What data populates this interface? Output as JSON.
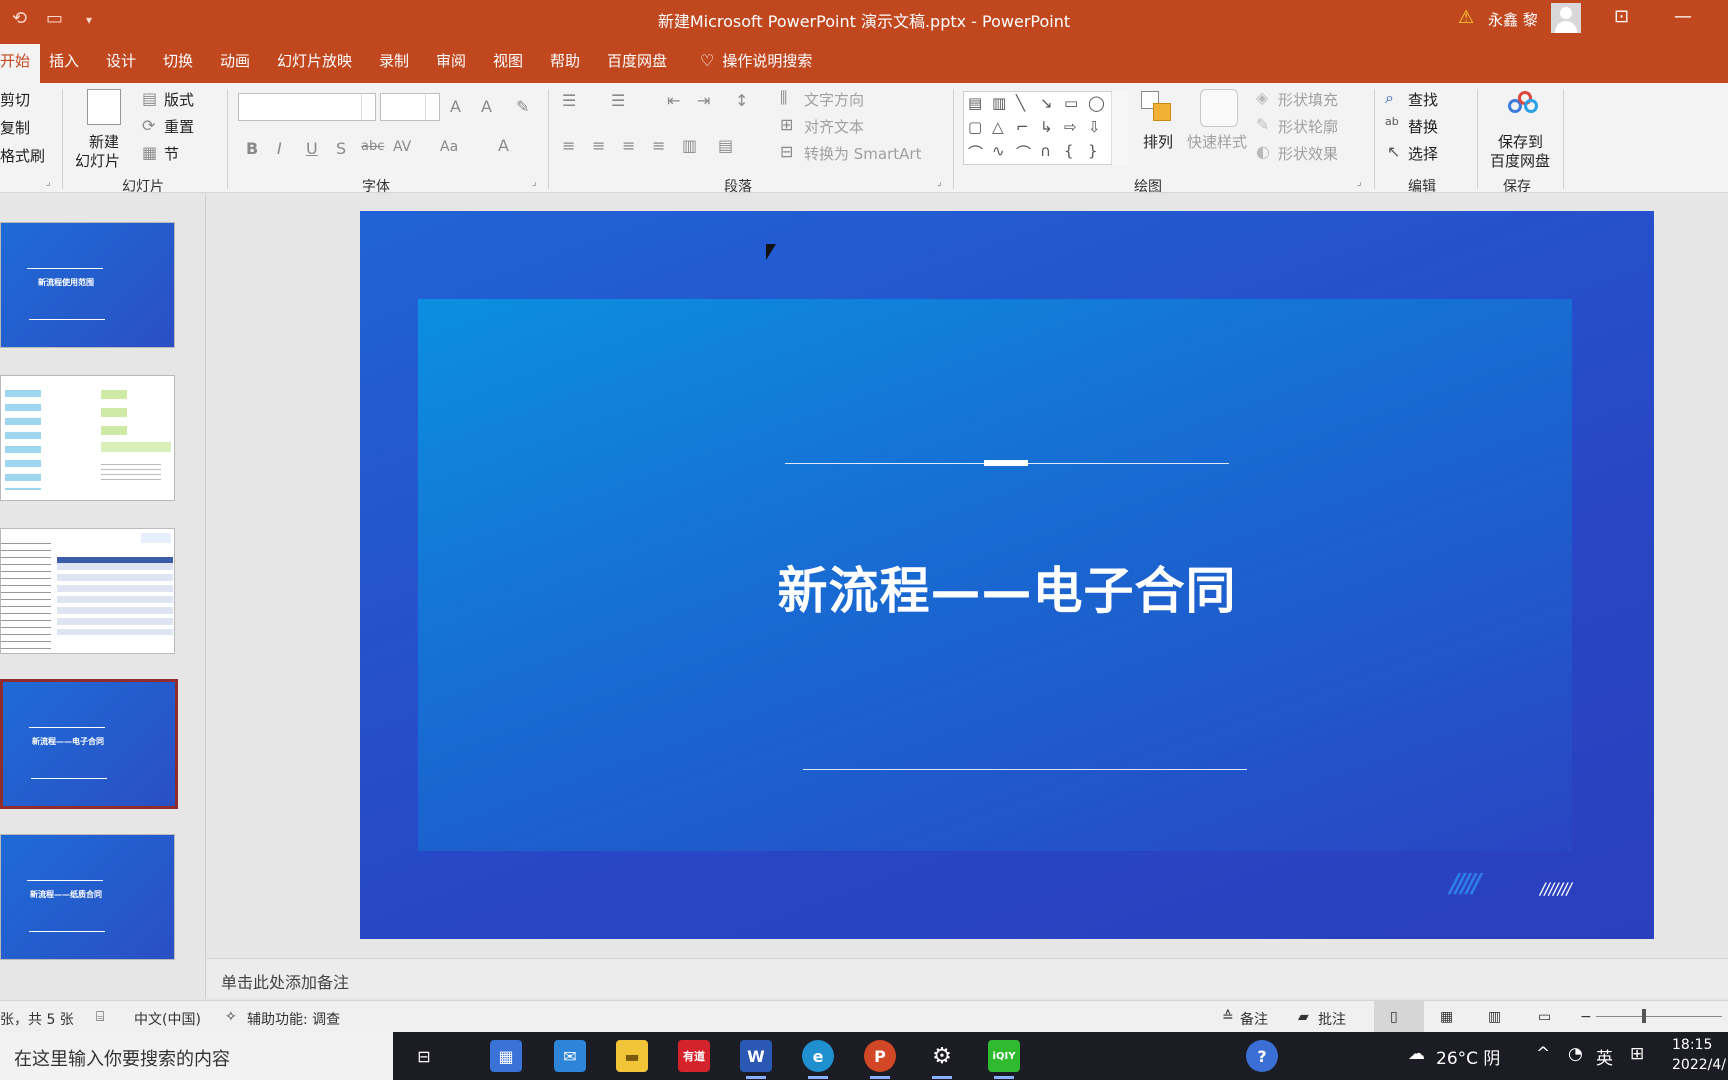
{
  "titlebar": {
    "title": "新建Microsoft PowerPoint 演示文稿.pptx  -  PowerPoint",
    "user": "永鑫 黎"
  },
  "menu": {
    "tabs": [
      "开始",
      "插入",
      "设计",
      "切换",
      "动画",
      "幻灯片放映",
      "录制",
      "审阅",
      "视图",
      "帮助",
      "百度网盘"
    ],
    "search": "操作说明搜索"
  },
  "ribbon": {
    "clipboard": {
      "cut": "剪切",
      "copy": "复制",
      "format": "格式刷"
    },
    "slides": {
      "new_line1": "新建",
      "new_line2": "幻灯片",
      "layout": "版式",
      "reset": "重置",
      "section": "节",
      "label": "幻灯片"
    },
    "font": {
      "label": "字体"
    },
    "paragraph": {
      "text_dir": "文字方向",
      "align_text": "对齐文本",
      "smartart": "转换为 SmartArt",
      "label": "段落"
    },
    "drawing": {
      "arrange": "排列",
      "quick_styles": "快速样式",
      "fill": "形状填充",
      "outline": "形状轮廓",
      "effects": "形状效果",
      "label": "绘图"
    },
    "editing": {
      "find": "查找",
      "replace": "替换",
      "select": "选择",
      "label": "编辑"
    },
    "save": {
      "line1": "保存到",
      "line2": "百度网盘",
      "label": "保存"
    }
  },
  "thumbnails": [
    {
      "title": "新流程使用范围",
      "kind": "blue"
    },
    {
      "title": "",
      "kind": "white"
    },
    {
      "title": "",
      "kind": "white"
    },
    {
      "title": "新流程——电子合同",
      "kind": "blue",
      "selected": true
    },
    {
      "title": "新流程——纸质合同",
      "kind": "blue"
    }
  ],
  "slide": {
    "title": "新流程——电子合同"
  },
  "notes": {
    "placeholder": "单击此处添加备注"
  },
  "status": {
    "slide_count": "张，共 5 张",
    "language": "中文(中国)",
    "accessibility": "辅助功能: 调查",
    "notes": "备注",
    "comments": "批注"
  },
  "taskbar": {
    "search_placeholder": "在这里输入你要搜索的内容",
    "weather": "26°C  阴",
    "ime": "英",
    "time": "18:15",
    "date": "2022/4/"
  },
  "colors": {
    "accent": "#c1471f",
    "slide_blue": "#2850c8"
  }
}
